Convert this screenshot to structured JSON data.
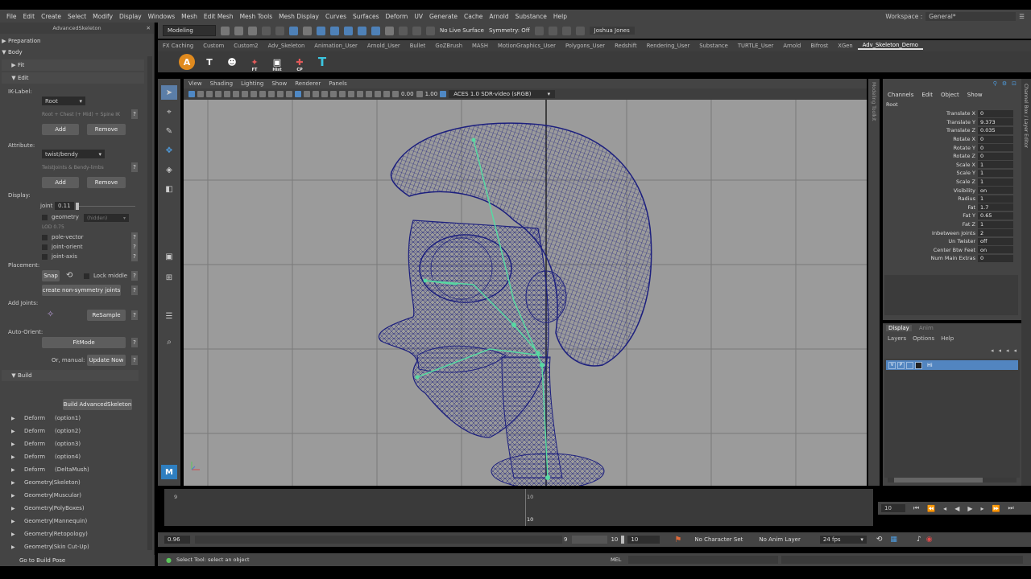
{
  "menubar": {
    "items": [
      "File",
      "Edit",
      "Create",
      "Select",
      "Modify",
      "Display",
      "Windows",
      "Mesh",
      "Edit Mesh",
      "Mesh Tools",
      "Mesh Display",
      "Curves",
      "Surfaces",
      "Deform",
      "UV",
      "Generate",
      "Cache",
      "Arnold",
      "Substance",
      "Help"
    ],
    "workspace_label": "Workspace :",
    "workspace_value": "General*"
  },
  "statusline": {
    "mode": "Modeling",
    "live_surface": "No Live Surface",
    "symmetry": "Symmetry: Off",
    "user": "Joshua Jones"
  },
  "shelf": {
    "tabs": [
      "FX Caching",
      "Custom",
      "Custom2",
      "Adv_Skeleton",
      "Animation_User",
      "Arnold_User",
      "Bullet",
      "GoZBrush",
      "MASH",
      "MotionGraphics_User",
      "Polygons_User",
      "Redshift",
      "Rendering_User",
      "Substance",
      "TURTLE_User",
      "Arnold",
      "Bifrost",
      "XGen",
      "Adv_Skeleton_Demo"
    ],
    "active_tab": "Adv_Skeleton_Demo",
    "icon_labels": [
      "A",
      "T",
      "☻",
      "FT",
      "Hist",
      "CP",
      "T"
    ],
    "ft": "FT",
    "hist": "Hist",
    "cp": "CP"
  },
  "leftpanel": {
    "title": "AdvancedSkeleton",
    "preparation": "Preparation",
    "body": "Body",
    "fit": "Fit",
    "edit": "Edit",
    "ik_label": "IK-Label:",
    "ik_value": "Root",
    "ik_hint": "Root + Chest (+ Mid) + Spine IK",
    "add": "Add",
    "remove": "Remove",
    "attribute": "Attribute:",
    "attribute_value": "twist/bendy",
    "attribute_hint": "TwistJoints & Bendy-limbs",
    "display": "Display:",
    "joint_label": "joint",
    "joint_value": "0.11",
    "geometry": "geometry",
    "geometry_dd": "(hidden)",
    "lod_label": "LOD",
    "lod_value": "0.75",
    "pole_vector": "pole-vector",
    "joint_orient": "joint-orient",
    "joint_axis": "joint-axis",
    "placement": "Placement:",
    "snap": "Snap",
    "lock_middle": "Lock middle",
    "create_nonsym": "create non-symmetry joints",
    "add_joints": "Add Joints:",
    "resample": "ReSample",
    "auto_orient": "Auto-Orient:",
    "fitmode": "FitMode",
    "or_manual": "Or, manual:",
    "update_now": "Update Now",
    "build": "Build",
    "build_button": "Build AdvancedSkeleton",
    "rows": [
      {
        "name": "Deform",
        "opt": "(option1)"
      },
      {
        "name": "Deform",
        "opt": "(option2)"
      },
      {
        "name": "Deform",
        "opt": "(option3)"
      },
      {
        "name": "Deform",
        "opt": "(option4)"
      },
      {
        "name": "Deform",
        "opt": "(DeltaMush)"
      },
      {
        "name": "Geometry",
        "opt": "(Skeleton)"
      },
      {
        "name": "Geometry",
        "opt": "(Muscular)"
      },
      {
        "name": "Geometry",
        "opt": "(PolyBoxes)"
      },
      {
        "name": "Geometry",
        "opt": "(Mannequin)"
      },
      {
        "name": "Geometry",
        "opt": "(Retopology)"
      },
      {
        "name": "Geometry",
        "opt": "(Skin Cut-Up)"
      }
    ],
    "go_to_build_pose": "Go to Build Pose"
  },
  "viewport": {
    "menu": [
      "View",
      "Shading",
      "Lighting",
      "Show",
      "Renderer",
      "Panels"
    ],
    "near_value": "0.00",
    "far_value": "1.00",
    "colorspace": "ACES 1.0 SDR-video (sRGB)"
  },
  "channelstrip": {
    "label": "Modeling Toolkit"
  },
  "channelbox": {
    "menu": [
      "Channels",
      "Edit",
      "Object",
      "Show"
    ],
    "object": "Root",
    "attrs": [
      {
        "name": "Translate X",
        "value": "0"
      },
      {
        "name": "Translate Y",
        "value": "9.373"
      },
      {
        "name": "Translate Z",
        "value": "0.035"
      },
      {
        "name": "Rotate X",
        "value": "0"
      },
      {
        "name": "Rotate Y",
        "value": "0"
      },
      {
        "name": "Rotate Z",
        "value": "0"
      },
      {
        "name": "Scale X",
        "value": "1"
      },
      {
        "name": "Scale Y",
        "value": "1"
      },
      {
        "name": "Scale Z",
        "value": "1"
      },
      {
        "name": "Visibility",
        "value": "on"
      },
      {
        "name": "Radius",
        "value": "1"
      },
      {
        "name": "Fat",
        "value": "1.7"
      },
      {
        "name": "Fat Y",
        "value": "0.65"
      },
      {
        "name": "Fat Z",
        "value": "1"
      },
      {
        "name": "Inbetween Joints",
        "value": "2"
      },
      {
        "name": "Un Twister",
        "value": "off"
      },
      {
        "name": "Center Btw Feet",
        "value": "on"
      },
      {
        "name": "Num Main Extras",
        "value": "0"
      }
    ],
    "side_label": "Channel Box / Layer Editor"
  },
  "layereditor": {
    "tabs": [
      "Display",
      "Anim"
    ],
    "menu": [
      "Layers",
      "Options",
      "Help"
    ],
    "layer_name": "Hi",
    "layer_v": "V",
    "layer_p": "P"
  },
  "timeslider": {
    "start_tick": "9",
    "mid_tick": "10",
    "current": "10",
    "current_frame": "10"
  },
  "rangebar": {
    "start": "0.96",
    "range_a": "9",
    "range_b": "10",
    "end": "10",
    "character": "No Character Set",
    "anim_layer": "No Anim Layer",
    "fps": "24 fps"
  },
  "helpline": {
    "text": "Select Tool: select an object",
    "mel": "MEL"
  },
  "colors": {
    "mesh": "#1c1f7e",
    "bones": "#57d9a3",
    "select_blue": "#5285c0"
  }
}
